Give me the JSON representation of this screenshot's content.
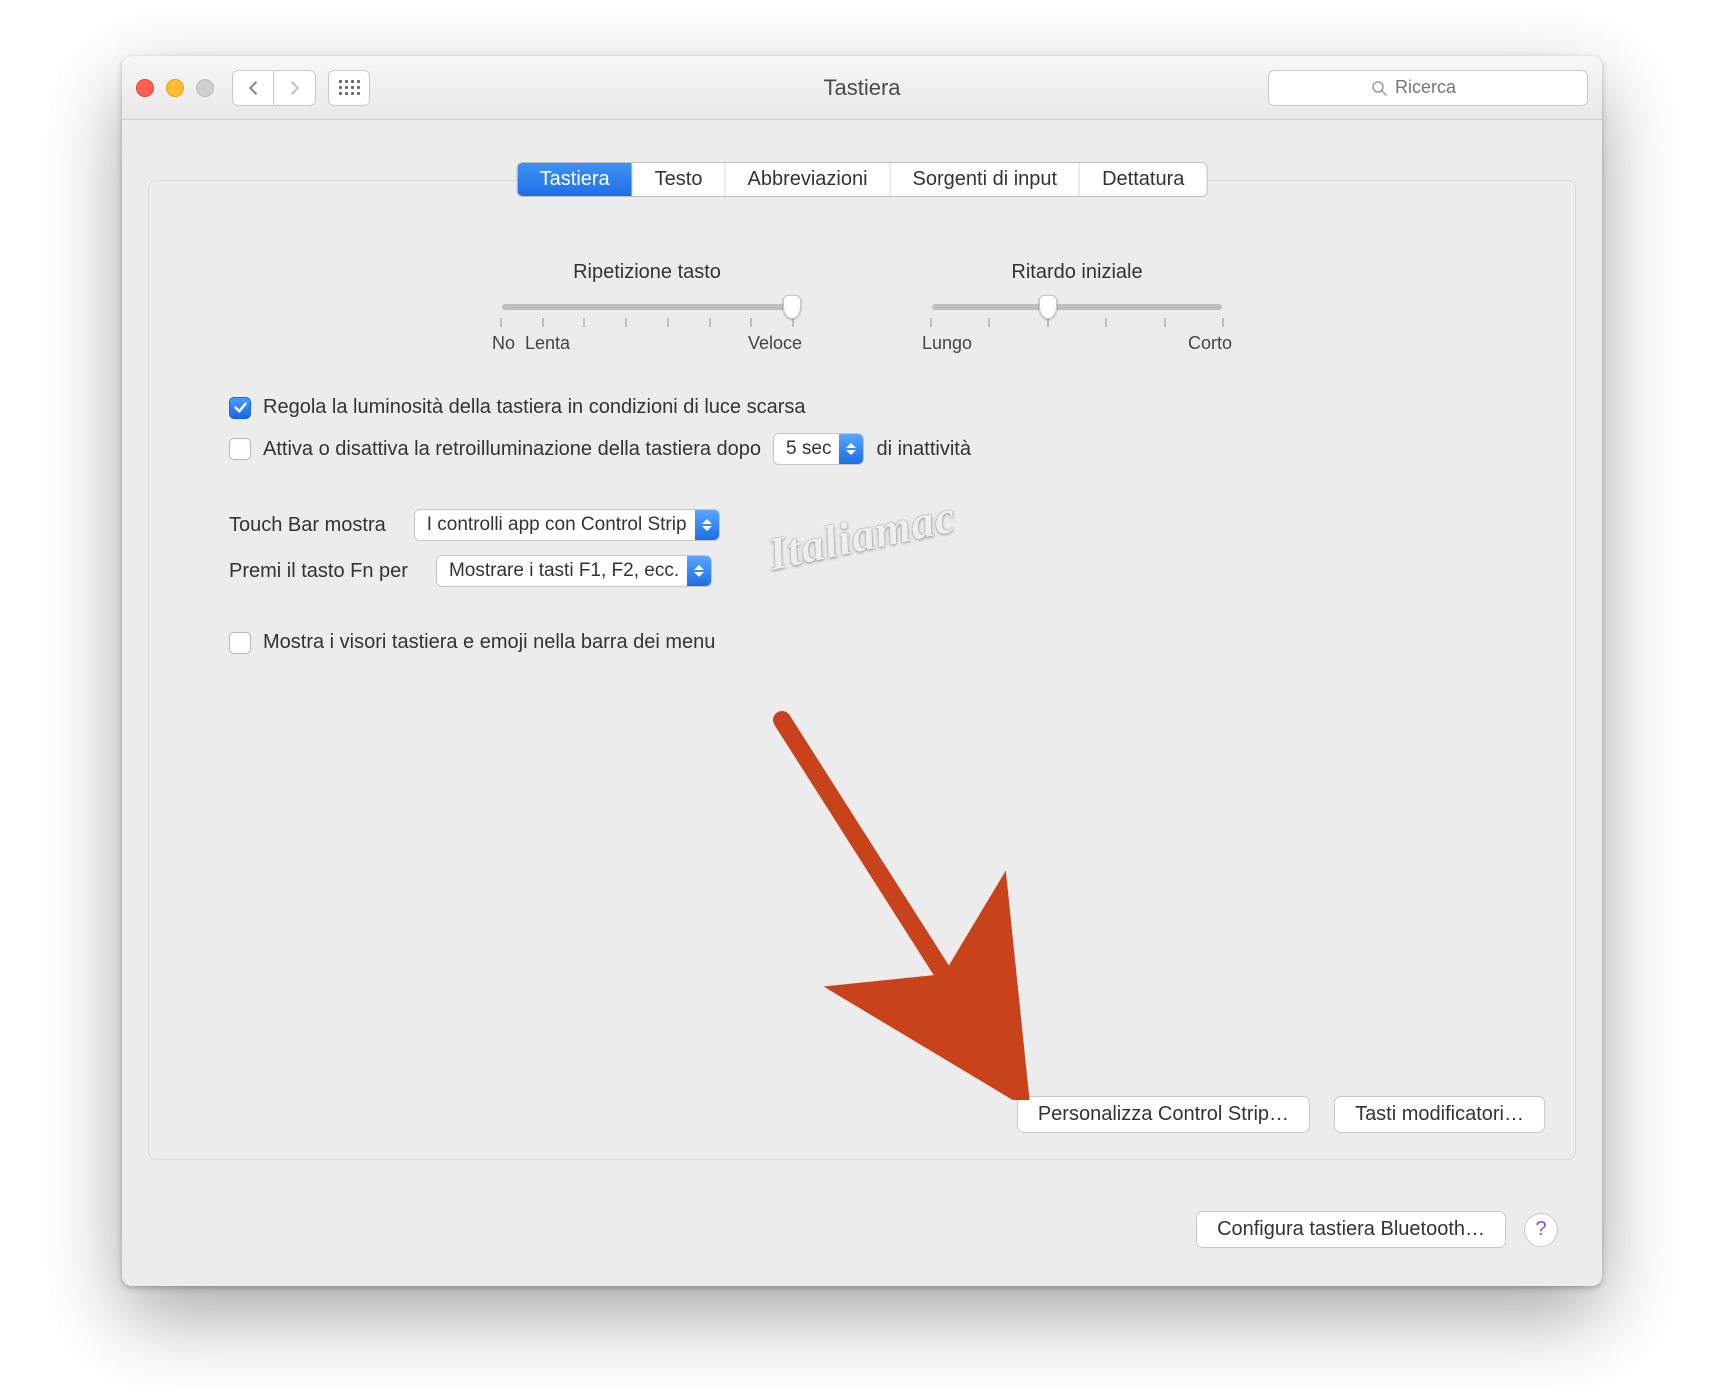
{
  "window": {
    "title": "Tastiera",
    "search_placeholder": "Ricerca"
  },
  "tabs": [
    "Tastiera",
    "Testo",
    "Abbreviazioni",
    "Sorgenti di input",
    "Dettatura"
  ],
  "active_tab": 0,
  "slider_left": {
    "label": "Ripetizione tasto",
    "min_label": "No",
    "min_label2": "Lenta",
    "max_label": "Veloce",
    "ticks": 8,
    "value_index": 7
  },
  "slider_right": {
    "label": "Ritardo iniziale",
    "min_label": "Lungo",
    "max_label": "Corto",
    "ticks": 6,
    "value_index": 2
  },
  "check_brightness": {
    "checked": true,
    "label": "Regola la luminosità della tastiera in condizioni di luce scarsa"
  },
  "check_backlight": {
    "checked": false,
    "label_before": "Attiva o disattiva la retroilluminazione della tastiera dopo",
    "select_value": "5 sec",
    "label_after": "di inattività"
  },
  "touchbar": {
    "label": "Touch Bar mostra",
    "value": "I controlli app con Control Strip"
  },
  "fnkey": {
    "label": "Premi il tasto Fn per",
    "value": "Mostrare i tasti F1, F2, ecc."
  },
  "check_viewers": {
    "checked": false,
    "label": "Mostra i visori tastiera e emoji nella barra dei menu"
  },
  "buttons": {
    "customize_strip": "Personalizza Control Strip…",
    "modifier_keys": "Tasti modificatori…",
    "bluetooth": "Configura tastiera Bluetooth…"
  },
  "watermark": "Italiamac"
}
